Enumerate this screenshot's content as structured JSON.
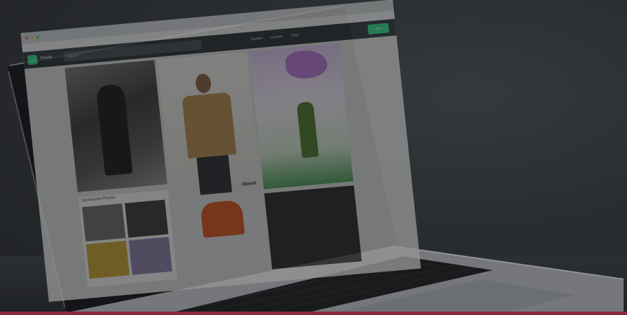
{
  "screen": {
    "browser": {
      "tabs": [
        "",
        "",
        "",
        "",
        "",
        ""
      ],
      "url": ""
    },
    "site": {
      "name": "Pexels",
      "search_placeholder": "Search",
      "nav": [
        "Explore",
        "License",
        "Tools"
      ],
      "join_label": "Join"
    },
    "photos": {
      "brand_watermark": "iStock",
      "sponsored_label": "Sponsored Photos"
    }
  },
  "colors": {
    "wall": "#35383c",
    "laptop_body": "#b9bbbd",
    "accent_green": "#2ecf82",
    "bottom_strip": "#8a2a3c"
  }
}
